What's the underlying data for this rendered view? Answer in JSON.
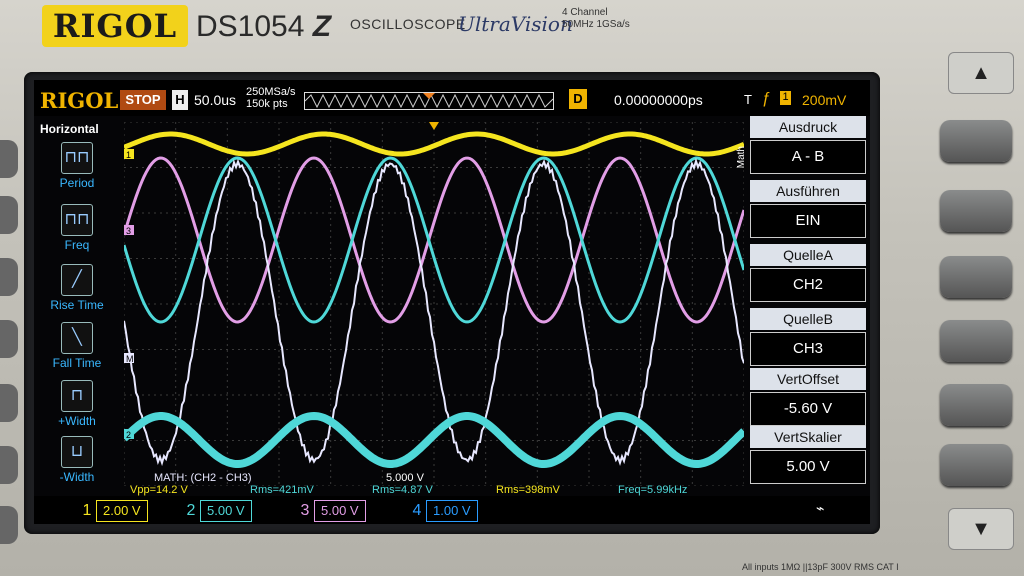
{
  "device": {
    "brand": "RIGOL",
    "model": "DS1054",
    "model_suffix": "Z",
    "type": "OSCILLOSCOPE",
    "series": "UltraVision",
    "spec_line1": "4 Channel",
    "spec_line2": "50MHz 1GSa/s",
    "bottom_note": "All inputs 1MΩ ||13pF 300V RMS CAT I"
  },
  "topbar": {
    "logo": "RIGOL",
    "run_state": "STOP",
    "horiz_label": "H",
    "timebase": "50.0us",
    "sample_rate": "250MSa/s",
    "mem_depth": "150k pts",
    "delay_label": "D",
    "delay": "0.00000000ps",
    "trigger_label": "T",
    "trigger_edge": "ƒ",
    "trigger_source": "1",
    "trigger_level": "200mV"
  },
  "left_menu": {
    "title": "Horizontal",
    "items": [
      {
        "label": "Period",
        "icon": "period-icon"
      },
      {
        "label": "Freq",
        "icon": "freq-icon"
      },
      {
        "label": "Rise Time",
        "icon": "rise-time-icon"
      },
      {
        "label": "Fall Time",
        "icon": "fall-time-icon"
      },
      {
        "label": "+Width",
        "icon": "pos-width-icon"
      },
      {
        "label": "-Width",
        "icon": "neg-width-icon"
      }
    ]
  },
  "right_menu": {
    "section": "Math",
    "items": [
      {
        "title": "Ausdruck",
        "value": "A - B"
      },
      {
        "title": "Ausführen",
        "value": "EIN"
      },
      {
        "title": "QuelleA",
        "value": "CH2"
      },
      {
        "title": "QuelleB",
        "value": "CH3"
      },
      {
        "title": "VertOffset",
        "value": "-5.60 V"
      },
      {
        "title": "VertSkalier",
        "value": "5.00 V"
      }
    ]
  },
  "math_bar": {
    "label": "MATH: (CH2 - CH3)",
    "scale": "5.000 V",
    "vpp": "Vpp=14.2 V",
    "rms1": "Rms=421mV",
    "rms2": "Rms=4.87 V",
    "rms3": "Rms=398mV",
    "freq": "Freq=5.99kHz"
  },
  "channels": [
    {
      "num": "1",
      "scale": "2.00 V",
      "color": "#f5e51f"
    },
    {
      "num": "2",
      "scale": "5.00 V",
      "color": "#4fd8d8"
    },
    {
      "num": "3",
      "scale": "5.00 V",
      "color": "#e29ee6"
    },
    {
      "num": "4",
      "scale": "1.00 V",
      "color": "#2a9cff"
    }
  ],
  "markers": {
    "math": "M",
    "ch1": "1",
    "ch2": "2",
    "ch3": "3",
    "ch4": "4",
    "trigger": "T"
  },
  "colors": {
    "ch1": "#f5e51f",
    "ch2": "#4fd8d8",
    "ch3": "#e29ee6",
    "math": "#e8e8ff",
    "grid": "#3a3a3a",
    "accent": "#f0b400"
  }
}
